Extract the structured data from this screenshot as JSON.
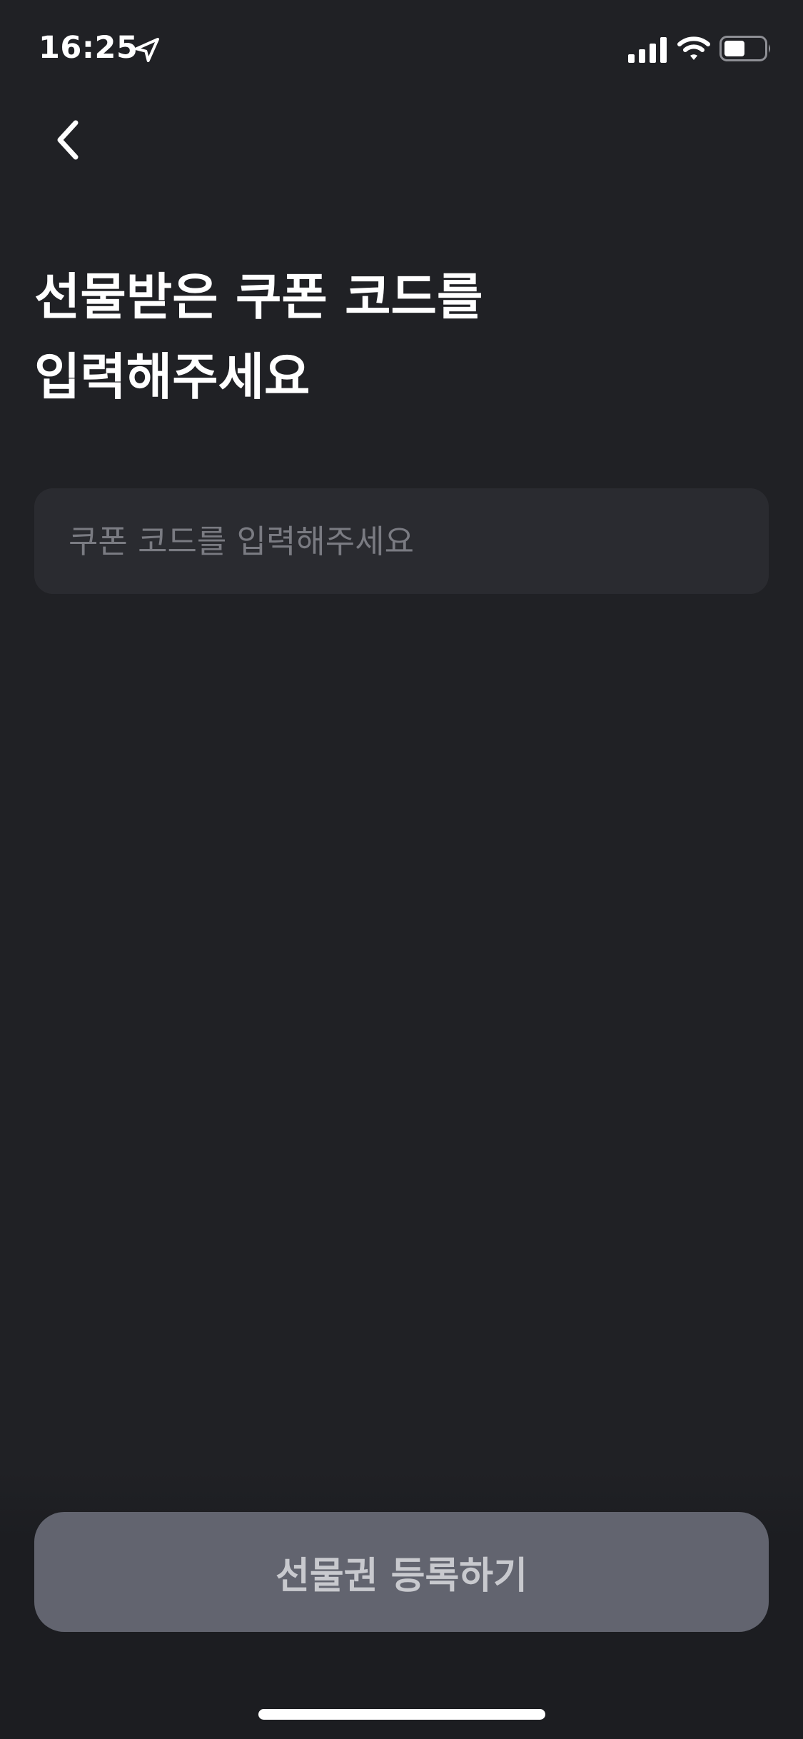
{
  "status_bar": {
    "time": "16:25",
    "icons": [
      "location-arrow-icon",
      "cellular-signal-icon",
      "wifi-icon",
      "battery-icon"
    ]
  },
  "header": {
    "back_icon": "chevron-left-icon"
  },
  "title": {
    "line1": "선물받은 쿠폰 코드를",
    "line2": "입력해주세요"
  },
  "coupon_input": {
    "value": "",
    "placeholder": "쿠폰 코드를 입력해주세요"
  },
  "register_button": {
    "label": "선물권 등록하기"
  },
  "colors": {
    "background": "#202125",
    "input_background": "#2a2b30",
    "placeholder": "#7a7b82",
    "button_background": "#62646f",
    "button_text": "#c8c9ce"
  }
}
